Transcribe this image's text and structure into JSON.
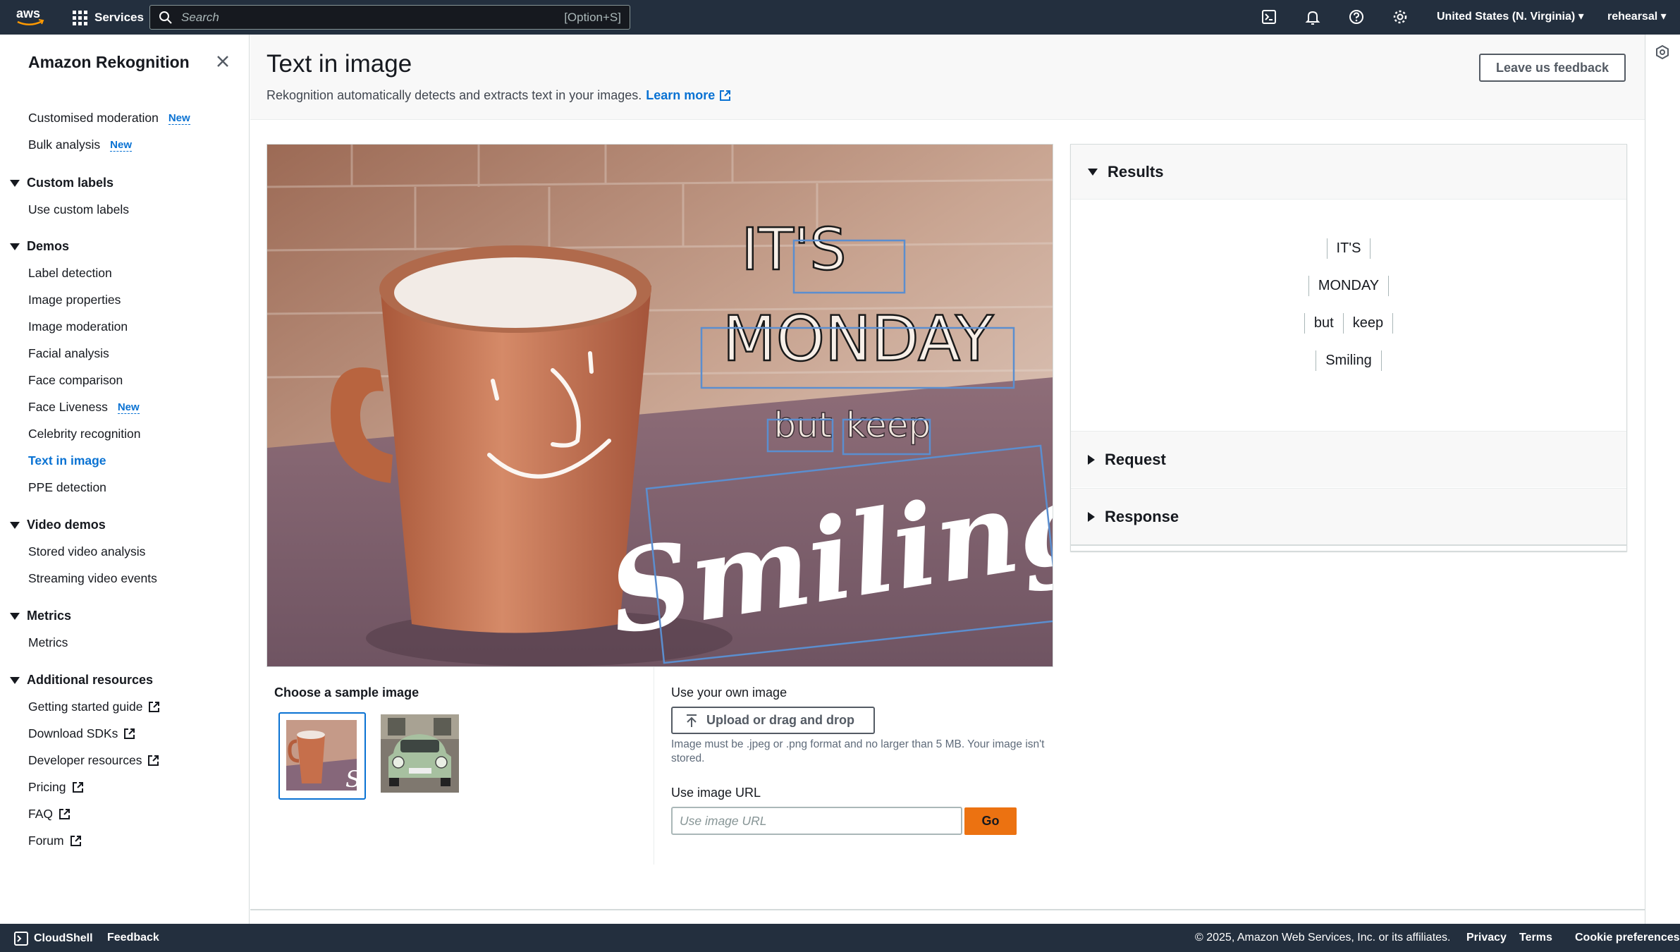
{
  "topnav": {
    "logo": "aws",
    "services_label": "Services",
    "search_placeholder": "Search",
    "search_shortcut": "[Option+S]",
    "region": "United States (N. Virginia) ▾",
    "account": "rehearsal ▾"
  },
  "sidebar": {
    "title": "Amazon Rekognition",
    "top_items": [
      {
        "label": "Customised moderation",
        "badge": "New"
      },
      {
        "label": "Bulk analysis",
        "badge": "New"
      }
    ],
    "sections": [
      {
        "heading": "Custom labels",
        "items": [
          "Use custom labels"
        ]
      },
      {
        "heading": "Demos",
        "items": [
          "Label detection",
          "Image properties",
          "Image moderation",
          "Facial analysis",
          "Face comparison",
          "Face Liveness",
          "Celebrity recognition",
          "Text in image",
          "PPE detection"
        ]
      },
      {
        "heading": "Video demos",
        "items": [
          "Stored video analysis",
          "Streaming video events"
        ]
      },
      {
        "heading": "Metrics",
        "items": [
          "Metrics"
        ]
      },
      {
        "heading": "Additional resources",
        "items": [
          "Getting started guide",
          "Download SDKs",
          "Developer resources",
          "Pricing",
          "FAQ",
          "Forum"
        ]
      }
    ],
    "face_liveness_badge": "New",
    "active_item": "Text in image"
  },
  "main": {
    "title": "Text in image",
    "description": "Rekognition automatically detects and extracts text in your images.",
    "learn_more": "Learn more",
    "feedback_button": "Leave us feedback",
    "image_text": {
      "line1": "IT'S",
      "line2": "MONDAY",
      "line3a": "but",
      "line3b": "keep",
      "line4": "Smiling"
    },
    "choose_sample": "Choose a sample image",
    "thumb_text": "S",
    "own_image_title": "Use your own image",
    "upload_button": "Upload or drag and drop",
    "upload_hint": "Image must be .jpeg or .png format and no larger than 5 MB. Your image isn't stored.",
    "url_title": "Use image URL",
    "url_placeholder": "Use image URL",
    "go_button": "Go"
  },
  "results": {
    "results_heading": "Results",
    "lines": [
      [
        "IT'S"
      ],
      [
        "MONDAY"
      ],
      [
        "but",
        "keep"
      ],
      [
        "Smiling"
      ]
    ],
    "request_heading": "Request",
    "response_heading": "Response"
  },
  "footer": {
    "cloudshell": "CloudShell",
    "feedback": "Feedback",
    "copyright": "© 2025, Amazon Web Services, Inc. or its affiliates.",
    "privacy": "Privacy",
    "terms": "Terms",
    "cookies": "Cookie preferences"
  },
  "colors": {
    "nav": "#232f3e",
    "link": "#0972d3",
    "accent": "#ec7211",
    "box": "#5b8ecf"
  }
}
